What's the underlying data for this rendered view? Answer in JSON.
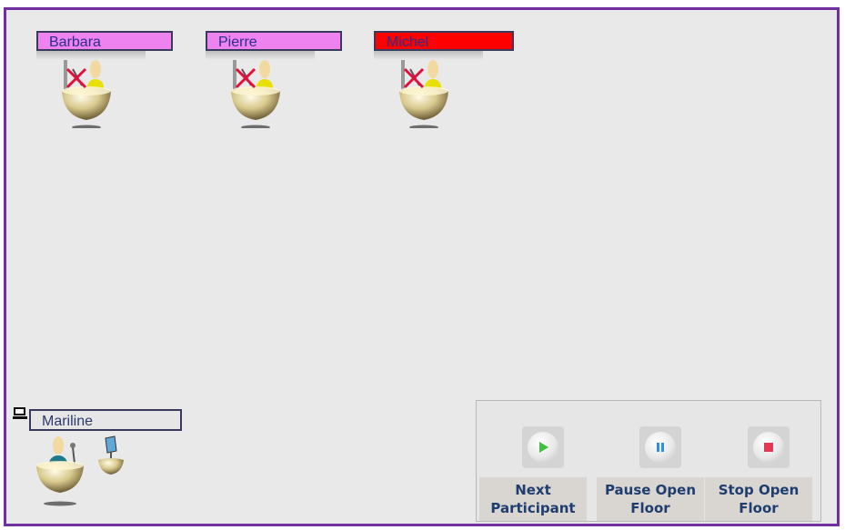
{
  "participants": [
    {
      "name": "Barbara",
      "color": "#ee82ee"
    },
    {
      "name": "Pierre",
      "color": "#ee82ee"
    },
    {
      "name": "Michel",
      "color": "#ff0000"
    }
  ],
  "host": {
    "name": "Mariline",
    "icon": "computer-icon"
  },
  "controls": {
    "next": {
      "label": "Next Participant",
      "icon": "play-icon",
      "color": "#3cc23c"
    },
    "pause": {
      "label": "Pause Open Floor",
      "icon": "pause-icon",
      "color": "#2e8fe0"
    },
    "stop": {
      "label": "Stop Open Floor",
      "icon": "stop-icon",
      "color": "#e23a55"
    }
  },
  "colors": {
    "frame": "#7030a0",
    "background": "#e9e9e9"
  }
}
